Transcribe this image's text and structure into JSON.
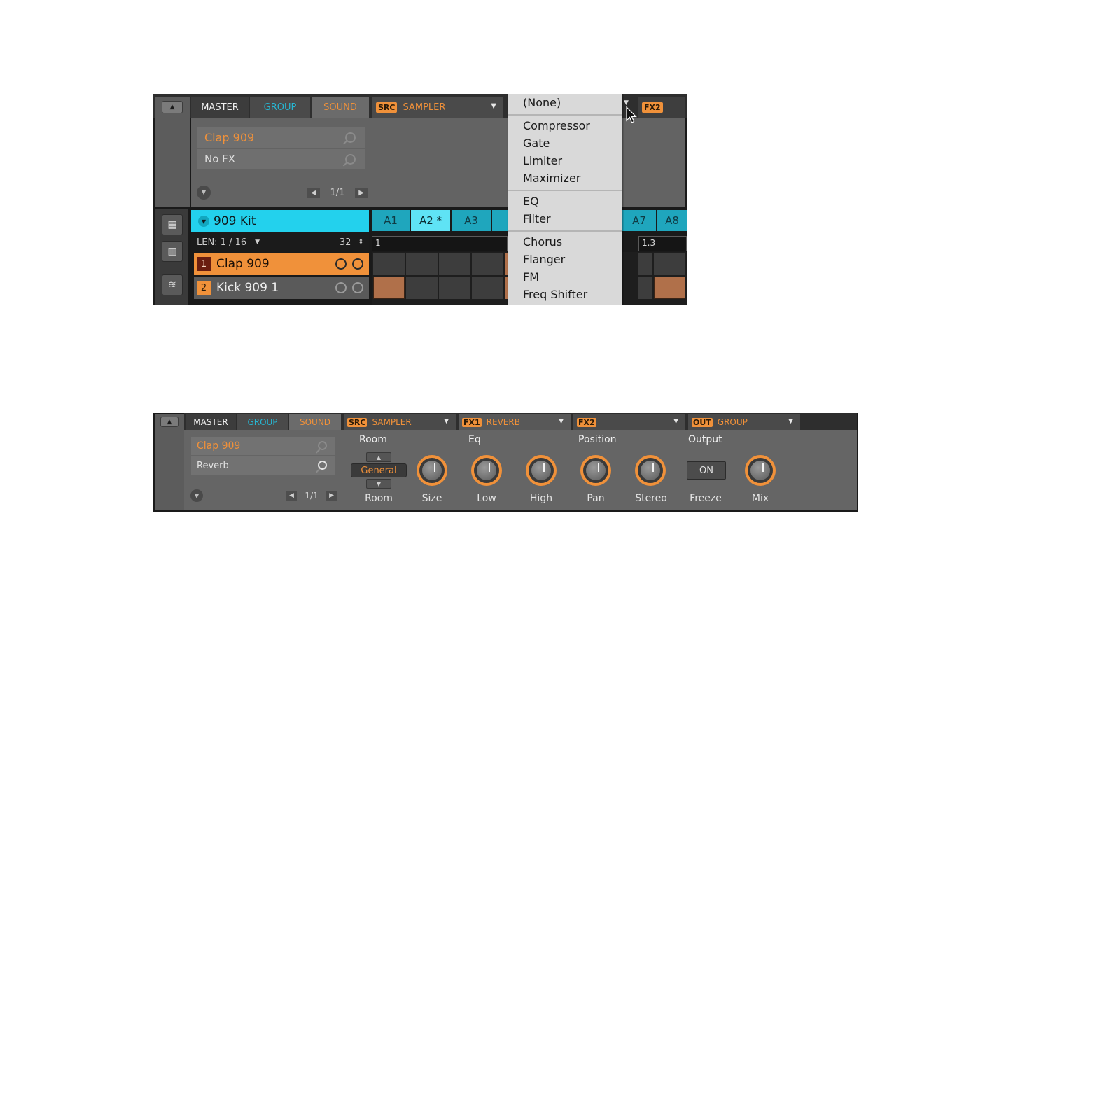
{
  "screen1": {
    "tabs": {
      "master": "MASTER",
      "group": "GROUP",
      "sound": "SOUND"
    },
    "src_slot": {
      "badge": "SRC",
      "value": "SAMPLER"
    },
    "fx2_badge": "FX2",
    "preset": {
      "name": "Clap 909",
      "fx": "No FX"
    },
    "page_indicator": "1/1",
    "kit_name": "909 Kit",
    "len": {
      "label": "LEN: 1 / 16",
      "value": "32"
    },
    "sounds": [
      {
        "num": "1",
        "name": "Clap 909"
      },
      {
        "num": "2",
        "name": "Kick 909 1"
      }
    ],
    "patterns": [
      "A1",
      "A2 *",
      "A3",
      "A7",
      "A8"
    ],
    "timeline": {
      "start": "1",
      "marker": "1.3"
    },
    "menu": {
      "none": "(None)",
      "group1": [
        "Compressor",
        "Gate",
        "Limiter",
        "Maximizer"
      ],
      "group2": [
        "EQ",
        "Filter"
      ],
      "group3": [
        "Chorus",
        "Flanger",
        "FM",
        "Freq Shifter"
      ]
    }
  },
  "screen2": {
    "tabs": {
      "master": "MASTER",
      "group": "GROUP",
      "sound": "SOUND"
    },
    "slots": {
      "src": {
        "badge": "SRC",
        "value": "SAMPLER"
      },
      "fx1": {
        "badge": "FX1",
        "value": "REVERB"
      },
      "fx2": {
        "badge": "FX2",
        "value": ""
      },
      "out": {
        "badge": "OUT",
        "value": "GROUP"
      }
    },
    "preset": {
      "name": "Clap 909",
      "fx": "Reverb"
    },
    "page_indicator": "1/1",
    "sections": {
      "room": "Room",
      "eq": "Eq",
      "position": "Position",
      "output": "Output"
    },
    "room_selector": "General",
    "freeze_button": "ON",
    "controls": {
      "room": "Room",
      "size": "Size",
      "low": "Low",
      "high": "High",
      "pan": "Pan",
      "stereo": "Stereo",
      "freeze": "Freeze",
      "mix": "Mix"
    }
  },
  "colors": {
    "orange": "#f0913a",
    "cyan": "#23d1ed",
    "menu_bg": "#d9d9d9"
  }
}
